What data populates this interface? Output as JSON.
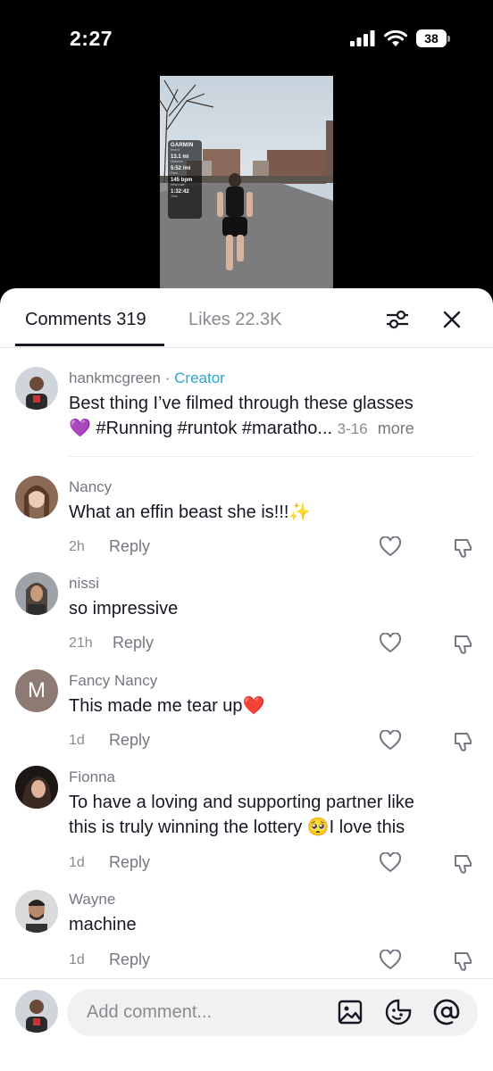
{
  "status_bar": {
    "time": "2:27",
    "battery": "38"
  },
  "video": {
    "overlay": {
      "brand": "GARMIN",
      "sub": "fenix 8",
      "stats": [
        {
          "value": "13.1 mi",
          "label": "Distance"
        },
        {
          "value": "5:52 /mi",
          "label": "Pace"
        },
        {
          "value": "145 bpm",
          "label": "Heart rate"
        },
        {
          "value": "1:32:42",
          "label": "Time"
        }
      ]
    }
  },
  "tabs": {
    "comments": "Comments 319",
    "likes": "Likes 22.3K"
  },
  "creator_comment": {
    "username": "hankmcgreen",
    "separator": " · ",
    "badge": "Creator",
    "line1": "Best thing I’ve filmed through these glasses",
    "emoji": "💜",
    "line2": " #Running #runtok #maratho...",
    "date": "3-16",
    "more": "more"
  },
  "comments": [
    {
      "username": "Nancy",
      "text": "What an effin beast she is!!!✨",
      "time": "2h",
      "reply": "Reply"
    },
    {
      "username": "nissi",
      "text": "so impressive",
      "time": "21h",
      "reply": "Reply"
    },
    {
      "username": "Fancy Nancy",
      "avatar_letter": "M",
      "text": "This made me tear up❤️",
      "time": "1d",
      "reply": "Reply"
    },
    {
      "username": "Fionna",
      "text_line1": "To have a loving and supporting partner like",
      "text_line2": "this is truly winning the lottery 🥺I love this",
      "time": "1d",
      "reply": "Reply"
    },
    {
      "username": "Wayne",
      "text": "machine",
      "time": "1d",
      "reply": "Reply"
    }
  ],
  "input": {
    "placeholder": "Add comment..."
  },
  "icons": [
    "signal-icon",
    "wifi-icon",
    "battery-icon",
    "filter-icon",
    "close-icon",
    "heart-icon",
    "dislike-icon",
    "image-icon",
    "sticker-icon",
    "mention-icon"
  ],
  "colors": {
    "creator": "#2ca5cf",
    "text": "#161823",
    "muted": "#8a8b91"
  }
}
